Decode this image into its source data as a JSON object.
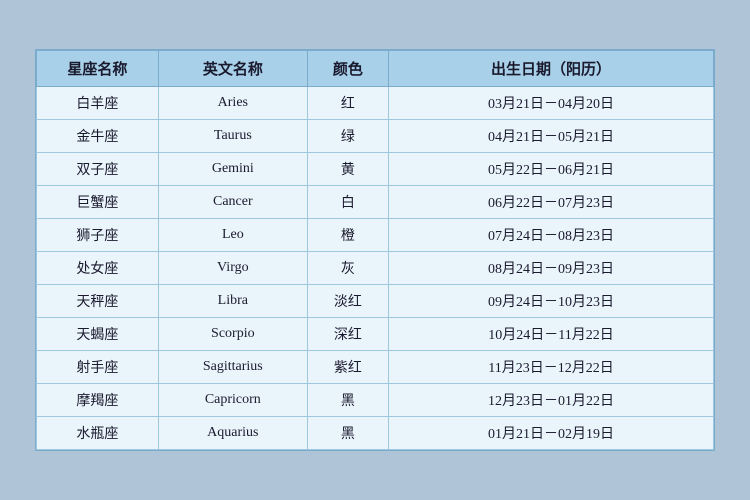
{
  "table": {
    "headers": {
      "chinese_name": "星座名称",
      "english_name": "英文名称",
      "color": "颜色",
      "birth_date": "出生日期（阳历）"
    },
    "rows": [
      {
        "chinese": "白羊座",
        "english": "Aries",
        "color": "红",
        "date": "03月21日－04月20日"
      },
      {
        "chinese": "金牛座",
        "english": "Taurus",
        "color": "绿",
        "date": "04月21日－05月21日"
      },
      {
        "chinese": "双子座",
        "english": "Gemini",
        "color": "黄",
        "date": "05月22日－06月21日"
      },
      {
        "chinese": "巨蟹座",
        "english": "Cancer",
        "color": "白",
        "date": "06月22日－07月23日"
      },
      {
        "chinese": "狮子座",
        "english": "Leo",
        "color": "橙",
        "date": "07月24日－08月23日"
      },
      {
        "chinese": "处女座",
        "english": "Virgo",
        "color": "灰",
        "date": "08月24日－09月23日"
      },
      {
        "chinese": "天秤座",
        "english": "Libra",
        "color": "淡红",
        "date": "09月24日－10月23日"
      },
      {
        "chinese": "天蝎座",
        "english": "Scorpio",
        "color": "深红",
        "date": "10月24日－11月22日"
      },
      {
        "chinese": "射手座",
        "english": "Sagittarius",
        "color": "紫红",
        "date": "11月23日－12月22日"
      },
      {
        "chinese": "摩羯座",
        "english": "Capricorn",
        "color": "黑",
        "date": "12月23日－01月22日"
      },
      {
        "chinese": "水瓶座",
        "english": "Aquarius",
        "color": "黑",
        "date": "01月21日－02月19日"
      }
    ]
  }
}
